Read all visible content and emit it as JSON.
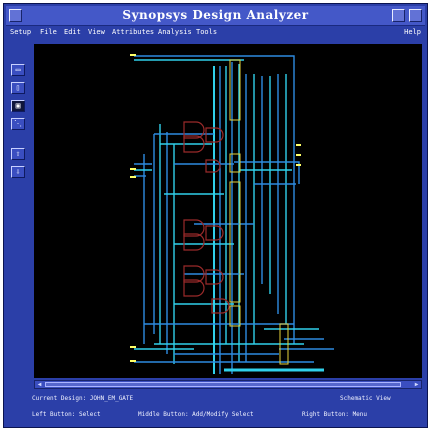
{
  "window": {
    "title": "Synopsys Design Analyzer"
  },
  "menubar": {
    "items": [
      "Setup",
      "File",
      "Edit",
      "View",
      "Attributes",
      "Analysis",
      "Tools"
    ],
    "help": "Help"
  },
  "toolbar": {
    "tools": [
      {
        "icon": "zoom-fit-icon",
        "glyph": "▭",
        "active": false
      },
      {
        "icon": "zoom-in-icon",
        "glyph": "▯",
        "active": false
      },
      {
        "icon": "zoom-box-icon",
        "glyph": "▣",
        "active": true
      },
      {
        "icon": "zoom-out-icon",
        "glyph": "⋱",
        "active": false
      },
      {
        "icon": "up-level-icon",
        "glyph": "⇧",
        "active": false
      },
      {
        "icon": "down-level-icon",
        "glyph": "⇩",
        "active": false
      }
    ]
  },
  "status": {
    "current_design": "Current Design: JOHN_EM_GATE",
    "view": "Schematic View",
    "left_button": "Left Button: Select",
    "middle_button": "Middle Button: Add/Modify Select",
    "right_button": "Right Button: Menu"
  },
  "colors": {
    "canvas": "#000000",
    "wire": "#2e8be0",
    "wire_bright": "#31d0ea",
    "gate": "#9a2a2a",
    "label": "#ffff66"
  }
}
